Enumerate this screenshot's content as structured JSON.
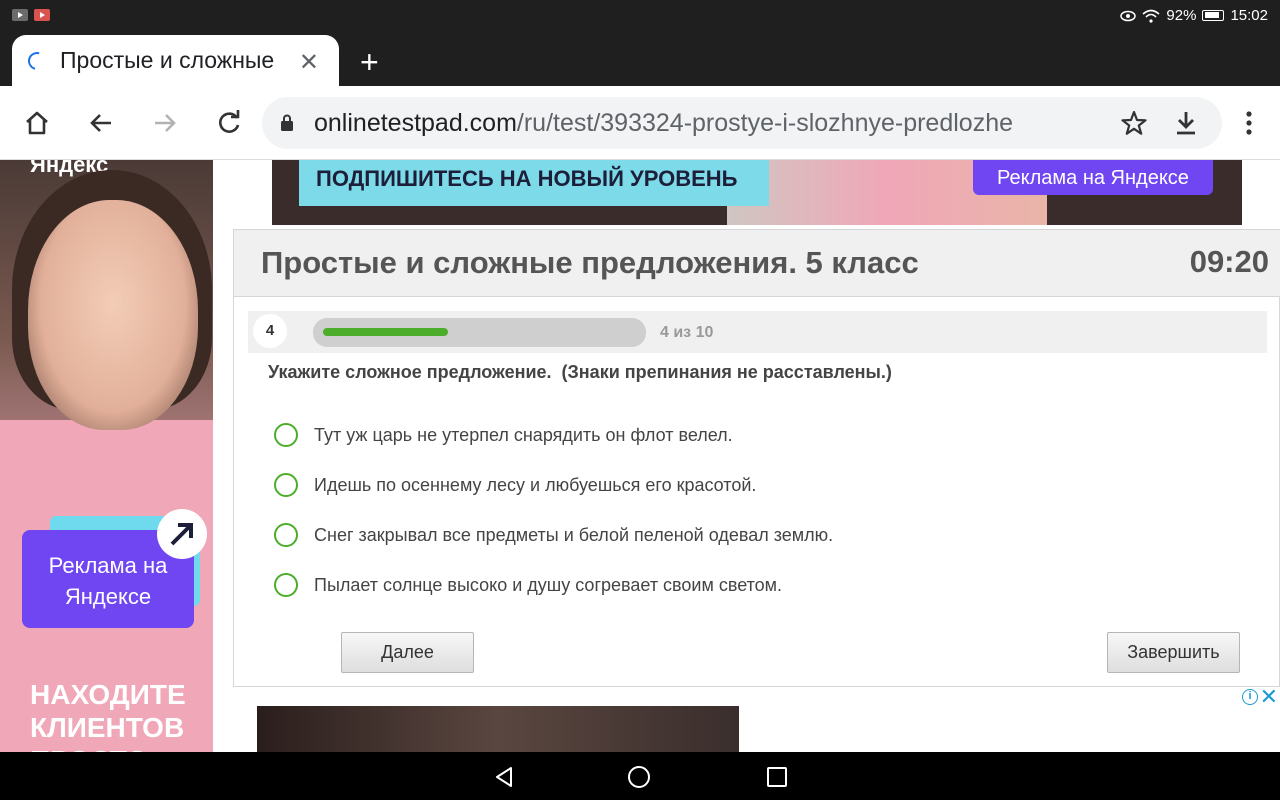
{
  "status": {
    "battery": "92%",
    "time": "15:02"
  },
  "browser": {
    "tab_title": "Простые и сложные",
    "url_host": "onlinetestpad.com",
    "url_path": "/ru/test/393324-prostye-i-slozhnye-predlozhe"
  },
  "ads": {
    "left_brand": "Яндекс",
    "left_cta": "Реклама на Яндексе",
    "left_headline": "НАХОДИТЕ КЛИЕНТОВ ПРОСТО",
    "top_text": "ПОДПИШИТЕСЬ НА НОВЫЙ УРОВЕНЬ",
    "top_cta": "Реклама на Яндексе",
    "info_glyph": "i",
    "close_glyph": "✕"
  },
  "test": {
    "title": "Простые и сложные предложения. 5 класс",
    "timer": "09:20",
    "question_number": "4",
    "progress_text": "4 из 10",
    "progress_fraction": 0.4,
    "question": "Укажите сложное предложение.  (Знаки препинания не расставлены.)",
    "answers": [
      "Тут уж царь не утерпел снарядить он флот велел.",
      "Идешь по осеннему лесу и любуешься его красотой.",
      "Снег закрывал все предметы и белой пеленой одевал землю.",
      "Пылает солнце высоко и душу согревает своим светом."
    ],
    "next_label": "Далее",
    "finish_label": "Завершить"
  },
  "colors": {
    "accent_green": "#4cad2b",
    "yandex_purple": "#6f46f2"
  }
}
